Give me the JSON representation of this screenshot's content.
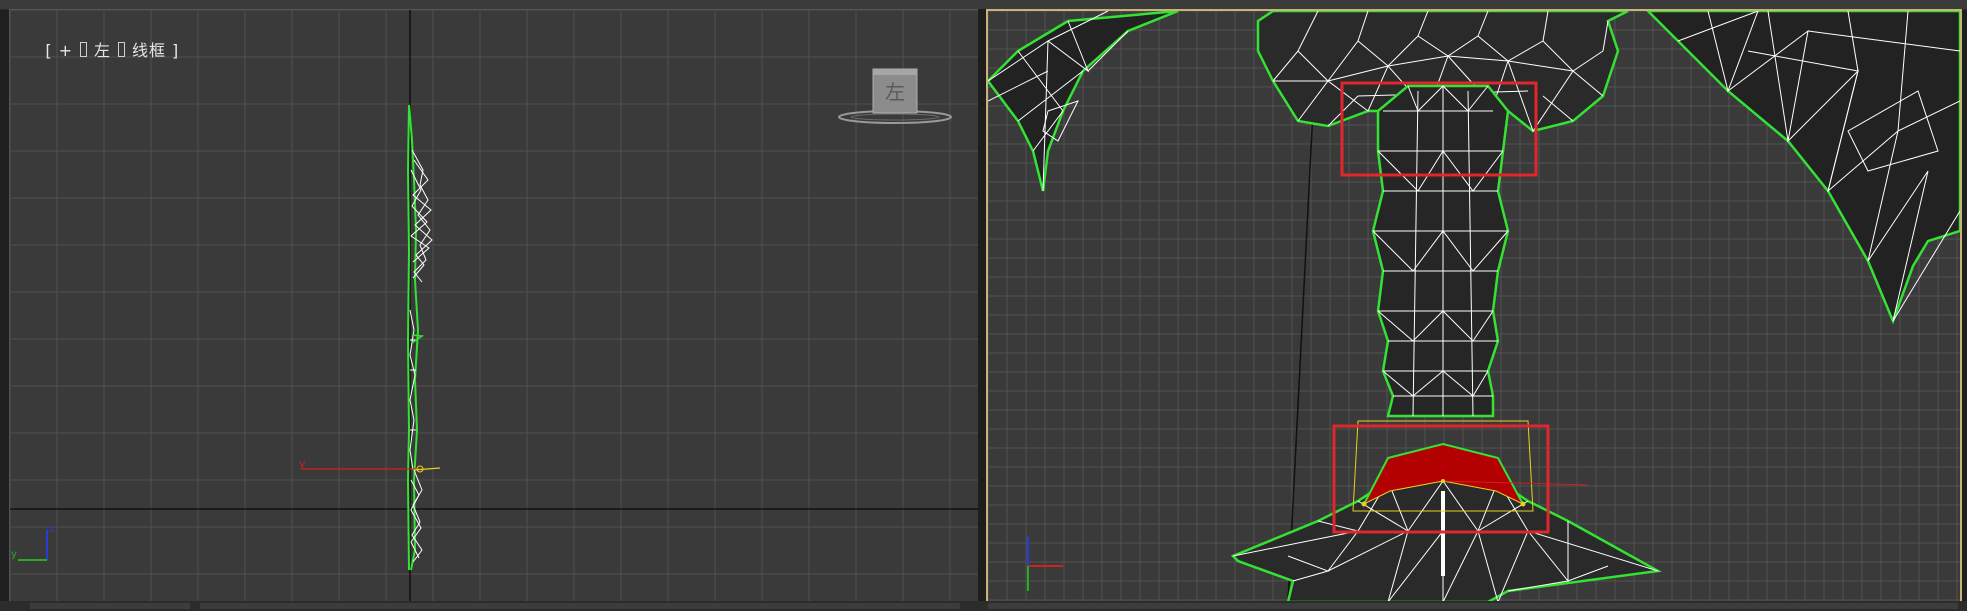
{
  "left_viewport": {
    "label": {
      "open": "[",
      "plus": "+",
      "view": "左",
      "mode": "线框",
      "close": "]"
    },
    "viewcube_face": "左",
    "axis_labels": {
      "z": "z",
      "y": "y",
      "gizmo_y": "y"
    }
  },
  "right_viewport": {
    "active": true,
    "highlight_color": "#e0272e",
    "selection_color": "#b30000"
  },
  "colors": {
    "wire_green": "#34e234",
    "wire_white": "#ffffff",
    "axis_red": "#d02020",
    "axis_blue": "#2a3bd6",
    "axis_green": "#20b020",
    "grid": "#505050",
    "viewport_bg": "#3a3a3a",
    "active_border": "#c8b478"
  }
}
